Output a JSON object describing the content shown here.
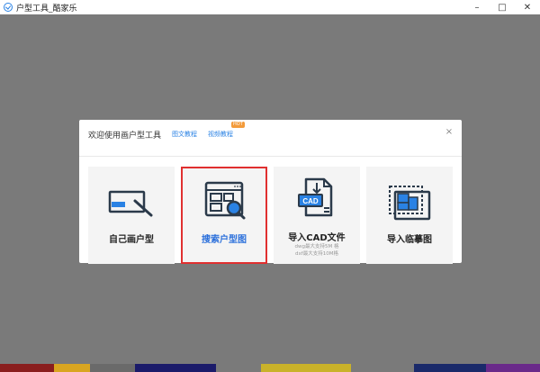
{
  "window": {
    "title": "户型工具_酷家乐",
    "minimize": "–",
    "maximize": "□",
    "close": "✕"
  },
  "modal": {
    "title": "欢迎使用画户型工具",
    "links": [
      {
        "label": "图文教程"
      },
      {
        "label": "视频教程",
        "badge": "HOT"
      }
    ],
    "close": "×",
    "cards": [
      {
        "label": "自己画户型",
        "icon": "draw-floorplan-icon"
      },
      {
        "label": "搜索户型图",
        "icon": "search-floorplan-icon",
        "selected": true
      },
      {
        "label": "导入CAD文件",
        "icon": "cad-file-icon",
        "sub1": "dwg最大支持5M  格",
        "sub2": "dxf最大支持10M格"
      },
      {
        "label": "导入临摹图",
        "icon": "import-trace-icon"
      }
    ]
  },
  "colors": {
    "accent": "#2a82e4",
    "overlay": "#7a7a7a",
    "selected_border": "#e03030",
    "badge": "#f39b3b"
  }
}
